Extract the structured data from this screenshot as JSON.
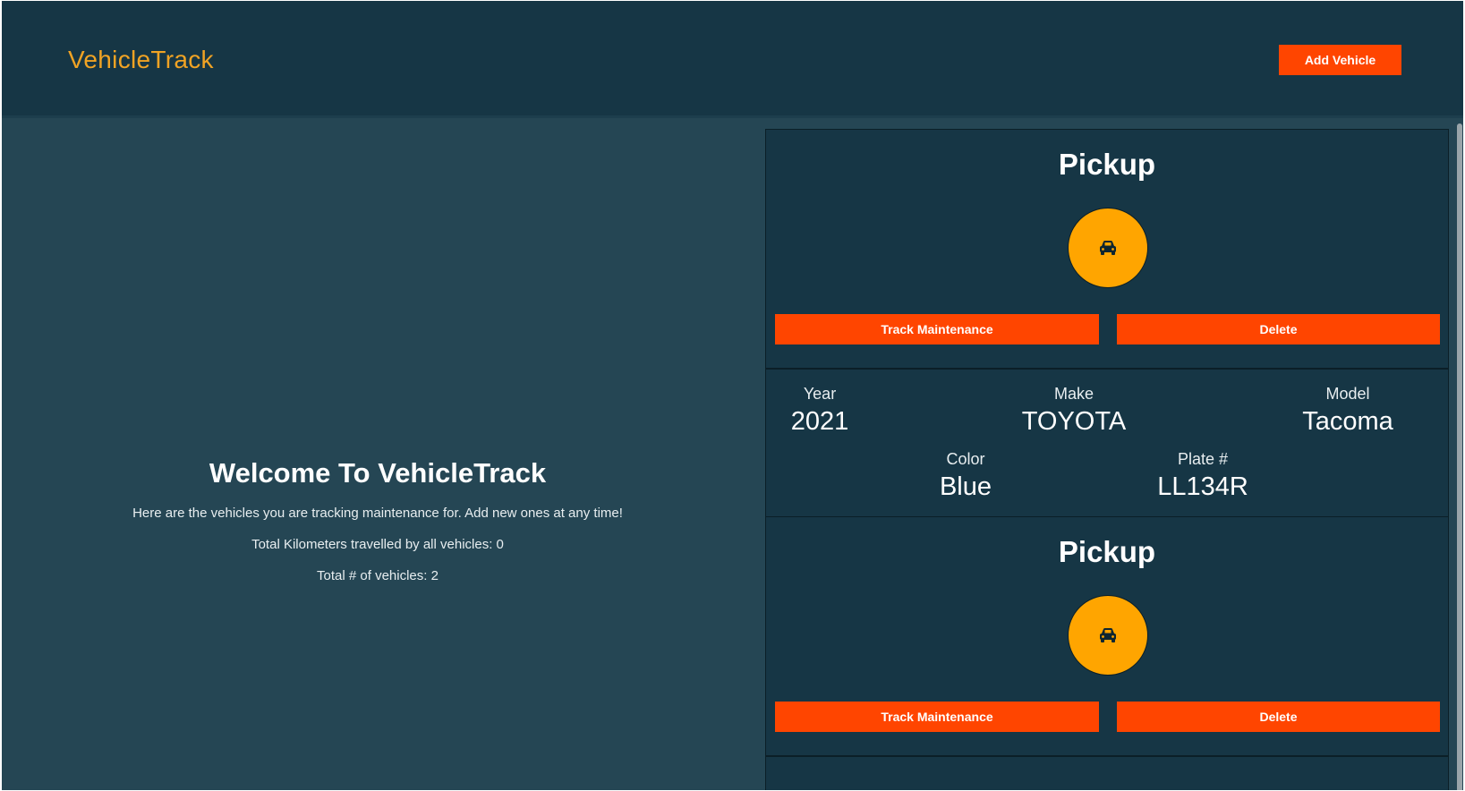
{
  "header": {
    "brand": "VehicleTrack",
    "add_vehicle_label": "Add Vehicle"
  },
  "welcome": {
    "title": "Welcome To VehicleTrack",
    "subtitle": "Here are the vehicles you are tracking maintenance for. Add new ones at any time!",
    "total_km": "Total Kilometers travelled by all vehicles: 0",
    "total_vehicles": "Total # of vehicles: 2"
  },
  "vehicles": [
    {
      "type": "Pickup",
      "icon": "car-icon",
      "track_label": "Track Maintenance",
      "delete_label": "Delete",
      "year_label": "Year",
      "year": "2021",
      "make_label": "Make",
      "make": "TOYOTA",
      "model_label": "Model",
      "model": "Tacoma",
      "color_label": "Color",
      "color": "Blue",
      "plate_label": "Plate #",
      "plate": "LL134R"
    },
    {
      "type": "Pickup",
      "icon": "car-icon",
      "track_label": "Track Maintenance",
      "delete_label": "Delete"
    }
  ],
  "colors": {
    "header_bg": "#163645",
    "page_bg": "#254654",
    "accent": "#ff4500",
    "brand": "#f0a324",
    "icon_circle": "#ffa500"
  }
}
